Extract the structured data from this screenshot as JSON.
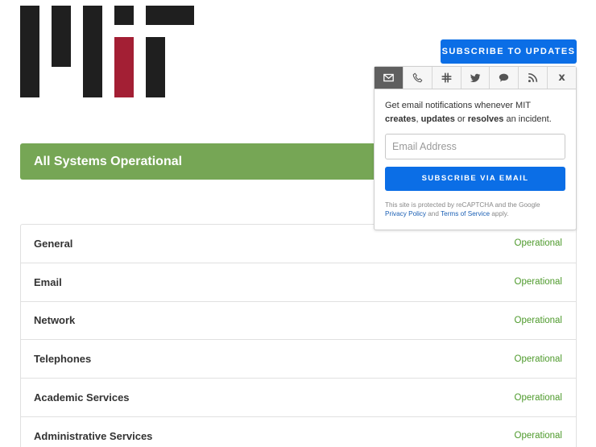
{
  "header": {
    "logo_name": "MIT logo",
    "subscribe_label": "SUBSCRIBE TO UPDATES"
  },
  "banner": {
    "text": "All Systems Operational",
    "color": "#76a655"
  },
  "components": [
    {
      "name": "General",
      "status": "Operational"
    },
    {
      "name": "Email",
      "status": "Operational"
    },
    {
      "name": "Network",
      "status": "Operational"
    },
    {
      "name": "Telephones",
      "status": "Operational"
    },
    {
      "name": "Academic Services",
      "status": "Operational"
    },
    {
      "name": "Administrative Services",
      "status": "Operational"
    }
  ],
  "popover": {
    "tabs": [
      {
        "icon": "envelope-icon",
        "active": true
      },
      {
        "icon": "phone-icon",
        "active": false
      },
      {
        "icon": "slack-icon",
        "active": false
      },
      {
        "icon": "twitter-icon",
        "active": false
      },
      {
        "icon": "chat-bubble-icon",
        "active": false
      },
      {
        "icon": "rss-icon",
        "active": false
      },
      {
        "icon": "close-icon",
        "active": false,
        "label": "x"
      }
    ],
    "description": {
      "intro": "Get email notifications whenever MIT",
      "creates": "creates",
      "comma": ",",
      "updates": "updates",
      "or": "or",
      "resolves": "resolves",
      "suffix": "an incident."
    },
    "email_placeholder": "Email Address",
    "email_value": "",
    "submit_label": "SUBSCRIBE VIA EMAIL",
    "recaptcha": {
      "prefix": "This site is protected by reCAPTCHA and the Google",
      "privacy_label": "Privacy Policy",
      "and": "and",
      "terms_label": "Terms of Service",
      "suffix": "apply."
    }
  },
  "colors": {
    "accent_blue": "#0b6ee6",
    "operational_green": "#4e9a2c",
    "mit_red": "#a31f34"
  }
}
